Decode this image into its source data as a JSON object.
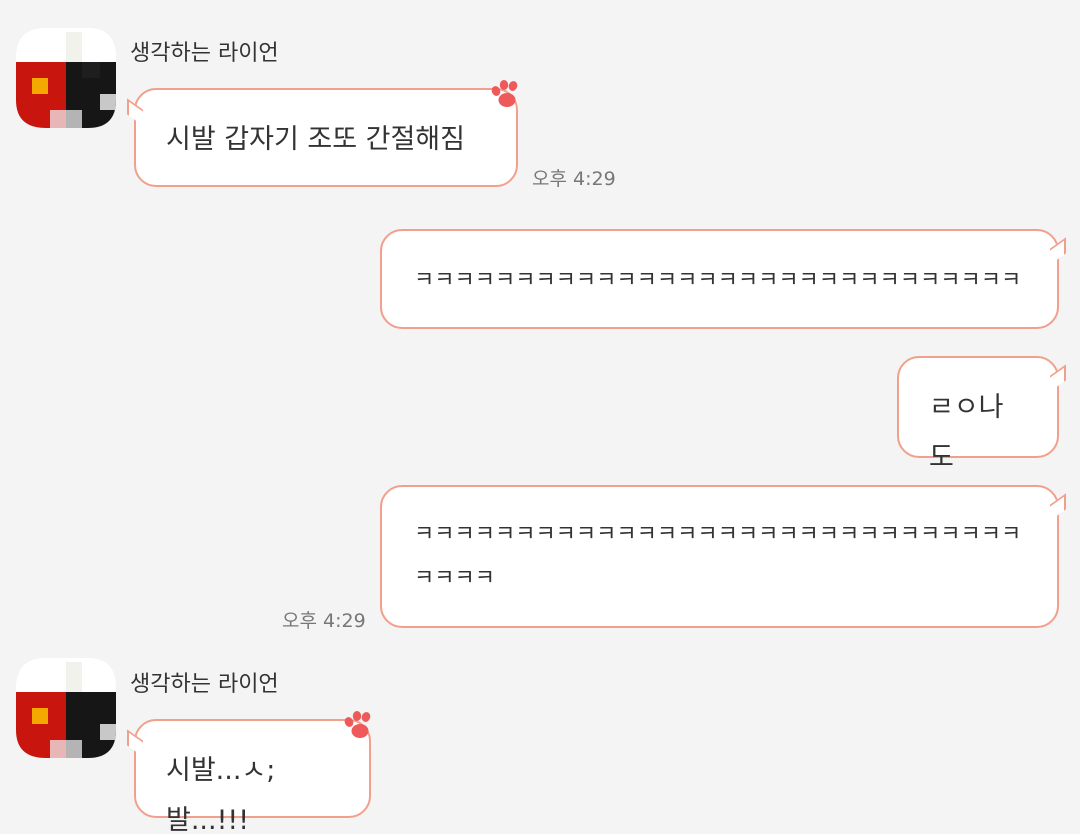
{
  "colors": {
    "background": "#f4f4f4",
    "bubble_border": "#f0a08c",
    "bubble_fill": "#ffffff",
    "paw": "#ee5a5a",
    "time_text": "#777777"
  },
  "messages": [
    {
      "direction": "incoming",
      "sender": "생각하는 라이언",
      "avatar_icon": "ryan-avatar-icon",
      "decoration_icon": "paw-icon",
      "text": "시발 갑자기 조또 간절해짐",
      "time": "오후 4:29"
    },
    {
      "direction": "outgoing",
      "text": "ㅋㅋㅋㅋㅋㅋㅋㅋㅋㅋㅋㅋㅋㅋㅋㅋㅋㅋㅋㅋㅋㅋㅋㅋㅋㅋㅋㅋㅋㅋ"
    },
    {
      "direction": "outgoing",
      "text": "ㄹㅇ나도"
    },
    {
      "direction": "outgoing",
      "text": "ㅋㅋㅋㅋㅋㅋㅋㅋㅋㅋㅋㅋㅋㅋㅋㅋㅋㅋㅋㅋㅋㅋㅋㅋㅋㅋㅋㅋㅋㅋㅋㅋㅋㅋ",
      "time": "오후 4:29"
    },
    {
      "direction": "incoming",
      "sender": "생각하는 라이언",
      "avatar_icon": "ryan-avatar-icon",
      "decoration_icon": "paw-icon",
      "text": "시발...ㅅ;발...!!!"
    }
  ]
}
